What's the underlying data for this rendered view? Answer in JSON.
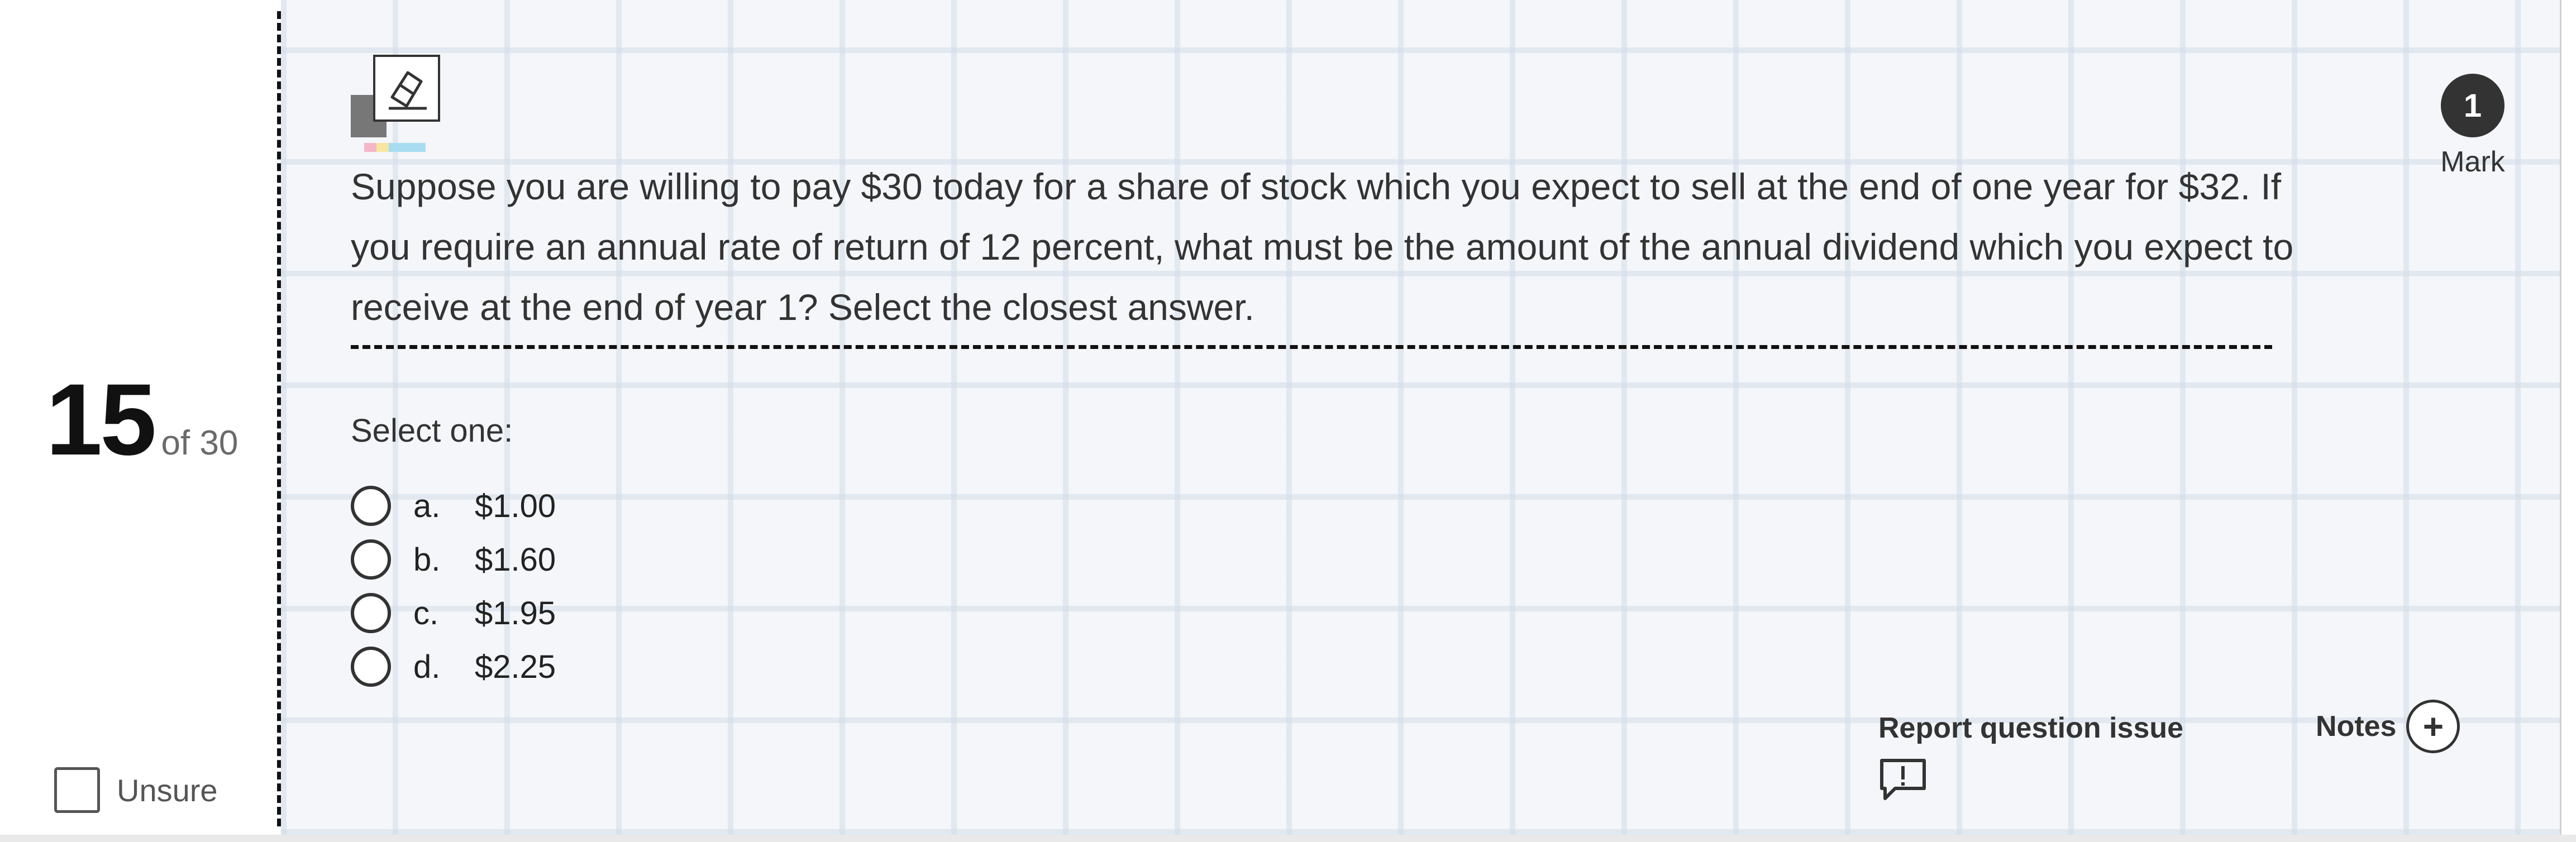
{
  "question_number": {
    "current": "15",
    "total": "of 30"
  },
  "unsure": {
    "label": "Unsure"
  },
  "mark": {
    "value": "1",
    "label": "Mark"
  },
  "question": {
    "text": "Suppose you are willing to pay $30 today for a share of stock which you expect to sell at the end of one year for $32. If you require an annual rate of return of 12 percent, what must be the amount of the annual dividend which you expect to receive at the end of year 1? Select the closest answer."
  },
  "answers": {
    "prompt": "Select one:",
    "options": [
      {
        "letter": "a.",
        "value": "$1.00"
      },
      {
        "letter": "b.",
        "value": "$1.60"
      },
      {
        "letter": "c.",
        "value": "$1.95"
      },
      {
        "letter": "d.",
        "value": "$2.25"
      }
    ]
  },
  "footer": {
    "report_label": "Report question issue",
    "notes_label": "Notes"
  },
  "icons": {
    "eraser": "eraser-icon",
    "report": "report-issue-icon",
    "notes_add": "plus-icon"
  }
}
